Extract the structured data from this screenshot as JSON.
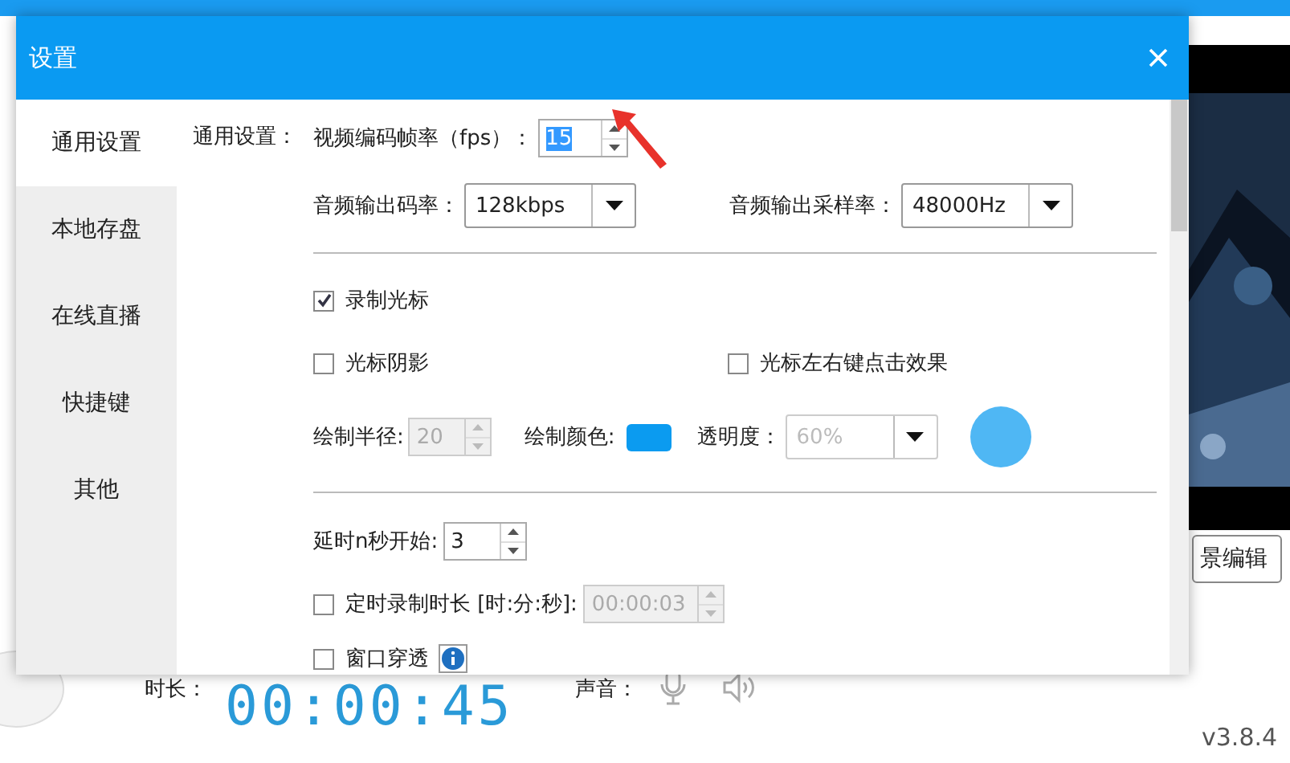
{
  "background_app": {
    "scene_button": "景编辑",
    "duration_label": "时长：",
    "duration": "00:00:45",
    "sound_label": "声音：",
    "version": "v3.8.4"
  },
  "dialog": {
    "title": "设置",
    "sidebar": [
      {
        "label": "通用设置",
        "selected": true
      },
      {
        "label": "本地存盘",
        "selected": false
      },
      {
        "label": "在线直播",
        "selected": false
      },
      {
        "label": "快捷键",
        "selected": false
      },
      {
        "label": "其他",
        "selected": false
      }
    ],
    "section_label": "通用设置：",
    "fps": {
      "label": "视频编码帧率（fps）：",
      "value": "15"
    },
    "audio_bitrate": {
      "label": "音频输出码率：",
      "value": "128kbps"
    },
    "audio_samplerate": {
      "label": "音频输出采样率：",
      "value": "48000Hz"
    },
    "record_cursor": {
      "label": "录制光标",
      "checked": true
    },
    "cursor_shadow": {
      "label": "光标阴影",
      "checked": false
    },
    "click_effect": {
      "label": "光标左右键点击效果",
      "checked": false
    },
    "radius": {
      "label": "绘制半径:",
      "value": "20",
      "disabled": true
    },
    "draw_color": {
      "label": "绘制颜色:",
      "color": "#0b9bf0"
    },
    "opacity": {
      "label": "透明度：",
      "value": "60%",
      "disabled": true
    },
    "delay": {
      "label": "延时n秒开始:",
      "value": "3",
      "disabled": false
    },
    "timer": {
      "label": "定时录制时长 [时:分:秒]:",
      "checked": false,
      "value": "00:00:03",
      "disabled": true
    },
    "click_through": {
      "label": "窗口穿透",
      "checked": false
    }
  }
}
